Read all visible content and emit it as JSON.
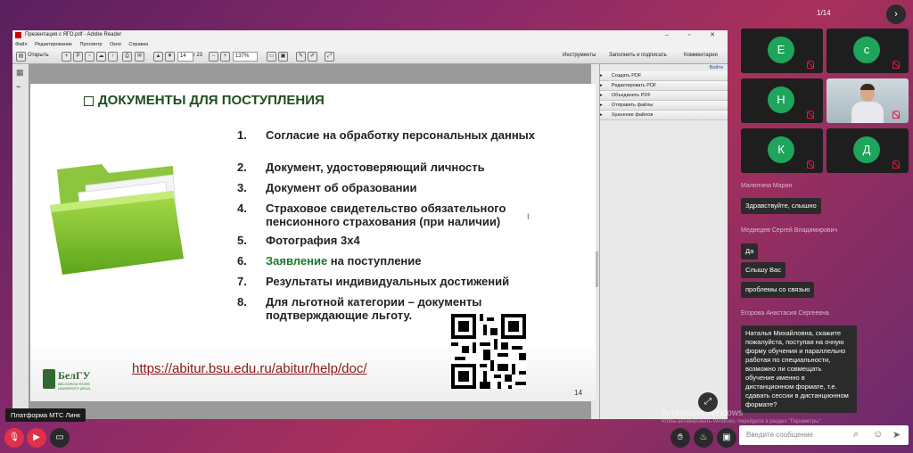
{
  "acrobat": {
    "window_title": "Презентация с ЯГО.pdf - Adobe Reader",
    "menu": [
      "Файл",
      "Редактирование",
      "Просмотр",
      "Окно",
      "Справка"
    ],
    "toolbar": {
      "open_label": "Открыть",
      "page_current": "14",
      "page_total": "/ 23",
      "zoom": "137%",
      "tools_label": "Инструменты",
      "fill_sign_label": "Заполнить и подписать",
      "comments_label": "Комментарии"
    },
    "right_panel": {
      "signin_label": "Войти",
      "items": [
        "Создать PDF",
        "Редактировать PDF",
        "Объединить PDF",
        "Отправить файлы",
        "Хранение файлов"
      ]
    }
  },
  "slide": {
    "title": "ДОКУМЕНТЫ ДЛЯ ПОСТУПЛЕНИЯ",
    "items": [
      {
        "num": "1.",
        "text": "Согласие на обработку персональных данных"
      },
      {
        "num": "2.",
        "text": "Документ, удостоверяющий личность"
      },
      {
        "num": "3.",
        "text": "Документ об образовании"
      },
      {
        "num": "4.",
        "text": "Страховое свидетельство обязательного пенсионного страхования (при наличии)"
      },
      {
        "num": "5.",
        "text": "Фотография 3х4"
      },
      {
        "num": "6.",
        "text_green": "Заявление",
        "text_rest": " на поступление"
      },
      {
        "num": "7.",
        "text": "Результаты индивидуальных достижений"
      },
      {
        "num": "8.",
        "text": "Для льготной категории – документы подтверждающие льготу."
      }
    ],
    "url": "https://abitur.bsu.edu.ru/abitur/help/doc/",
    "page_number": "14",
    "logo_text": "БелГУ",
    "logo_sub": "BELGOROD STATE UNIVERSITY (BSU)"
  },
  "conference": {
    "counter": "1/14",
    "participants": [
      {
        "initial": "Е"
      },
      {
        "initial": "с"
      },
      {
        "initial": "Н"
      },
      {
        "initial": ""
      },
      {
        "initial": "К"
      },
      {
        "initial": "Д"
      }
    ],
    "platform_label": "Платформа МТС Линк",
    "watermark_title": "Активация Windows",
    "watermark_text": "Чтобы активировать Windows, перейдите в раздел \"Параметры\".",
    "message_placeholder": "Введите сообщение"
  },
  "chat": [
    {
      "sender": "Малютина Мария",
      "messages": [
        "Здравствуйте, слышно"
      ]
    },
    {
      "sender": "Медведев Сергей Владимирович",
      "messages": [
        "Да",
        "Слышу Вас",
        "проблемы со связью"
      ]
    },
    {
      "sender": "Егорова Анастасия Сергеевна",
      "messages": [
        "Наталья Михайловна, скажите пожалуйста, поступая на очную форму обучения и параллельно работая по специальности, возможно ли совмещать обучение именно в дистанционном формате, т.е. сдавать сессии в дистанционном формате?"
      ]
    }
  ],
  "colors": {
    "accent_green": "#1ea55b",
    "mute_red": "#e0304a",
    "slide_title": "#1f4e1f"
  }
}
